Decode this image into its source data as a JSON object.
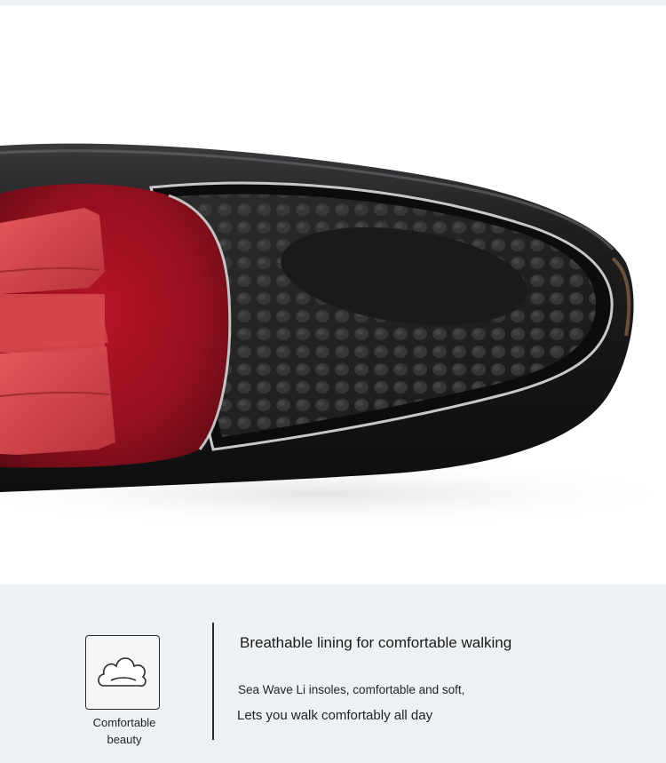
{
  "product_image": {
    "icon": "loafer-shoe-insole-photo"
  },
  "feature": {
    "icon": "comfort-cloud-icon",
    "caption_line1": "Comfortable",
    "caption_line2": "beauty",
    "title": "Breathable lining for comfortable walking",
    "description_line1": "Sea Wave Li insoles, comfortable and soft,",
    "description_line2": "Lets you walk comfortably all day"
  },
  "colors": {
    "band_background": "#eef1f4",
    "velvet_red": "#9b1020",
    "bow_red": "#d9454c",
    "leather_black": "#1c1c1e"
  }
}
